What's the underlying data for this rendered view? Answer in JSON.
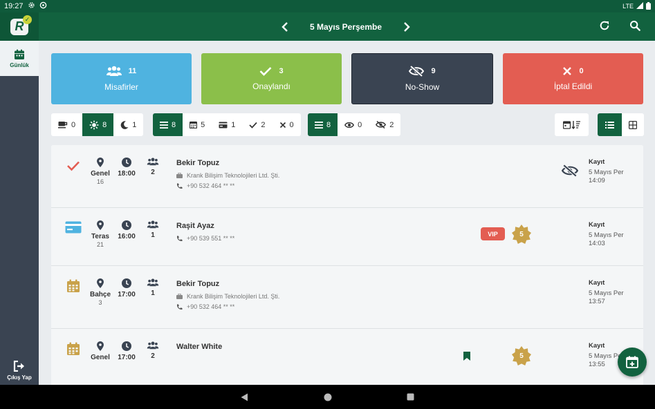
{
  "status_bar": {
    "time": "19:27",
    "network": "LTE"
  },
  "app": {
    "logo_letter": "R"
  },
  "header": {
    "date_title": "5 Mayıs Perşembe"
  },
  "sidebar": {
    "active_label": "Günlük",
    "logout_label": "Çıkış Yap"
  },
  "summary": [
    {
      "count": "11",
      "label": "Misafirler",
      "color": "#4fb3e0",
      "icon": "users-icon"
    },
    {
      "count": "3",
      "label": "Onaylandı",
      "color": "#8bbf4a",
      "icon": "check-icon"
    },
    {
      "count": "9",
      "label": "No-Show",
      "color": "#3a4452",
      "icon": "eye-slash-icon"
    },
    {
      "count": "0",
      "label": "İptal Edildi",
      "color": "#e35d52",
      "icon": "x-icon"
    }
  ],
  "filters": {
    "meal": [
      {
        "icon": "coffee-icon",
        "count": "0"
      },
      {
        "icon": "sun-icon",
        "count": "8",
        "active": true
      },
      {
        "icon": "moon-icon",
        "count": "1"
      }
    ],
    "status": [
      {
        "icon": "list-icon",
        "count": "8",
        "active": true
      },
      {
        "icon": "calendar-icon",
        "count": "5"
      },
      {
        "icon": "card-icon",
        "count": "1"
      },
      {
        "icon": "check-icon",
        "count": "2"
      },
      {
        "icon": "x-icon",
        "count": "0"
      }
    ],
    "show": [
      {
        "icon": "list-icon",
        "count": "8",
        "active": true
      },
      {
        "icon": "eye-icon",
        "count": "0"
      },
      {
        "icon": "eye-slash-icon",
        "count": "2"
      }
    ]
  },
  "reservations": [
    {
      "status_icon": "check-icon",
      "area": "Genel",
      "table": "16",
      "time": "18:00",
      "people": "2",
      "name": "Bekir Topuz",
      "company": "Krank Bilişim Teknolojileri Ltd. Şti.",
      "phone": "+90 532 464 ** **",
      "reg_title": "Kayıt",
      "reg_date": "5 Mayıs Per",
      "reg_time": "14:09"
    },
    {
      "status_icon": "card-icon",
      "area": "Teras",
      "table": "21",
      "time": "16:00",
      "people": "1",
      "name": "Raşit Ayaz",
      "phone": "+90 539 551 ** **",
      "vip": "VIP",
      "badge": "5",
      "reg_title": "Kayıt",
      "reg_date": "5 Mayıs Per",
      "reg_time": "14:03"
    },
    {
      "status_icon": "calendar-icon",
      "area": "Bahçe",
      "table": "3",
      "time": "17:00",
      "people": "1",
      "name": "Bekir Topuz",
      "company": "Krank Bilişim Teknolojileri Ltd. Şti.",
      "phone": "+90 532 464 ** **",
      "reg_title": "Kayıt",
      "reg_date": "5 Mayıs Per",
      "reg_time": "13:57"
    },
    {
      "status_icon": "calendar-icon",
      "area": "Genel",
      "time": "17:00",
      "people": "2",
      "name": "Walter White",
      "badge": "5",
      "reg_title": "Kayıt",
      "reg_date": "5 Mayıs Per",
      "reg_time": "13:55"
    }
  ],
  "colors": {
    "brand": "#12623f",
    "dark": "#3a4452",
    "gold": "#c9a24a",
    "red": "#e35d52",
    "blue": "#4fb3e0"
  }
}
